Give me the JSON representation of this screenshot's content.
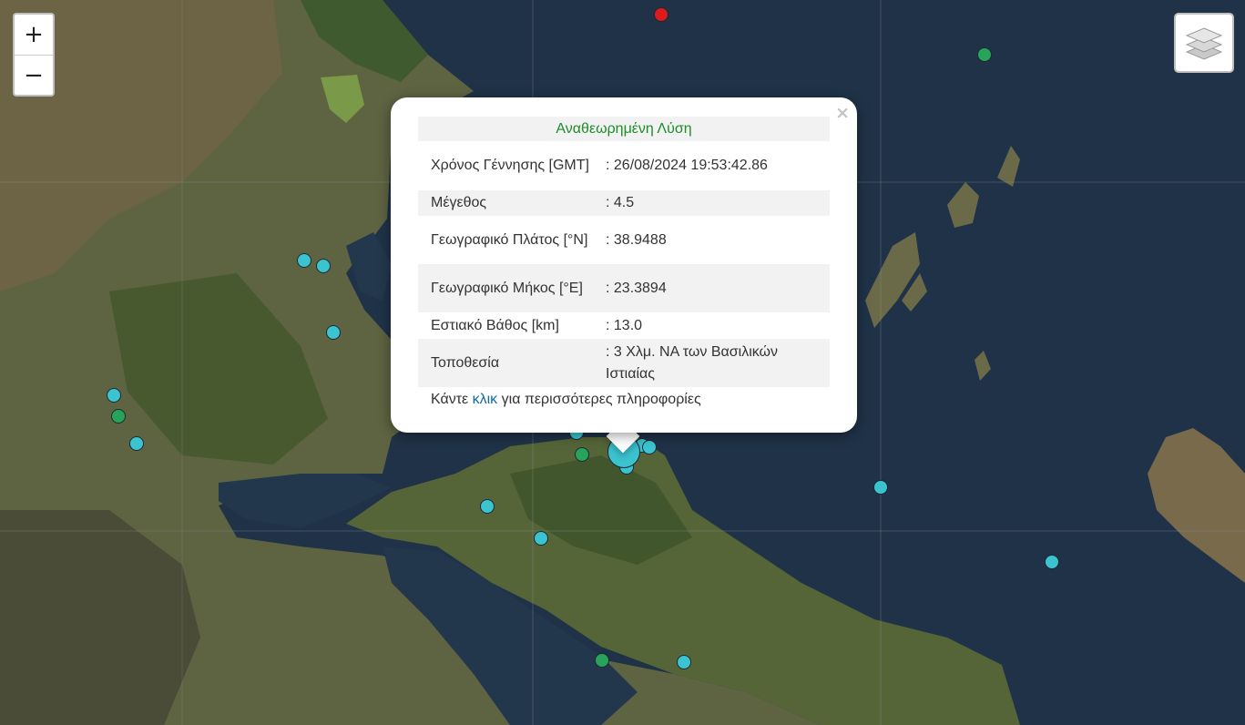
{
  "map": {
    "zoom_in_label": "+",
    "zoom_out_label": "−",
    "layers_icon": "layers-icon",
    "colors": {
      "marker_cyan": "#3bc4d0",
      "marker_green": "#27a35c",
      "marker_red": "#dd1b1b",
      "sea": "#1f3247",
      "land": "#5d6640"
    }
  },
  "popup": {
    "title": "Αναθεωρημένη Λύση",
    "close_label": "×",
    "rows": [
      {
        "label": "Χρόνος Γέννησης [GMT]",
        "value": ": 26/08/2024 19:53:42.86"
      },
      {
        "label": "Μέγεθος",
        "value": ": 4.5"
      },
      {
        "label": "Γεωγραφικό Πλάτος [°N]",
        "value": ": 38.9488"
      },
      {
        "label": "Γεωγραφικό Μήκος [°E]",
        "value": ": 23.3894"
      },
      {
        "label": "Εστιακό Βάθος [km]",
        "value": ": 13.0"
      },
      {
        "label": "Τοποθεσία",
        "value": ": 3 Χλμ. ΝΑ των Βασιλικών Ιστιαίας"
      }
    ],
    "footer_prefix": "Κάντε ",
    "footer_link": "κλικ",
    "footer_suffix": " για περισσότερες πληροφορίες"
  }
}
